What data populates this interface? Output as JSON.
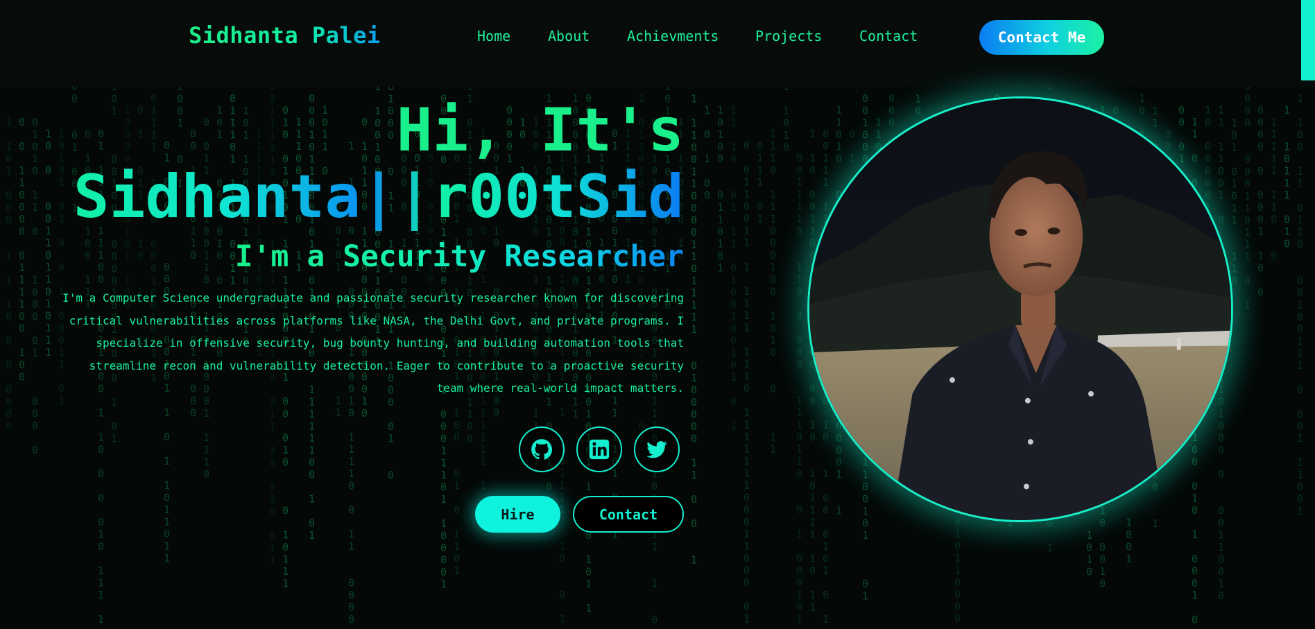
{
  "header": {
    "logo": "Sidhanta Palei",
    "nav": [
      "Home",
      "About",
      "Achievments",
      "Projects",
      "Contact"
    ],
    "cta": "Contact Me"
  },
  "hero": {
    "greeting": "Hi, It's",
    "name": "Sidhanta||r00tSid",
    "role": "I'm a Security Researcher",
    "bio": "I'm a Computer Science undergraduate and passionate security researcher known for discovering critical vulnerabilities across platforms like NASA, the Delhi Govt, and private programs. I specialize in offensive security, bug bounty hunting, and building automation tools that streamline recon and vulnerability detection. Eager to contribute to a proactive security team where real-world impact matters.",
    "socials": [
      "github-icon",
      "linkedin-icon",
      "twitter-icon"
    ],
    "hire_label": "Hire",
    "contact_label": "Contact"
  },
  "colors": {
    "accent_green": "#19ef8a",
    "accent_cyan": "#0ff2de",
    "accent_blue": "#0a7cf2",
    "background": "#040807"
  }
}
